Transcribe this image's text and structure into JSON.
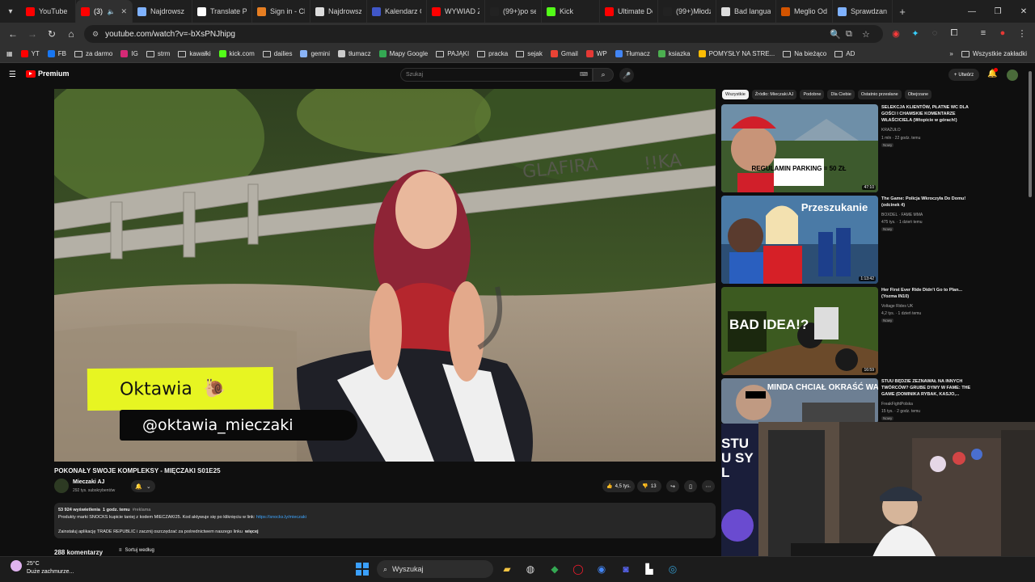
{
  "browser": {
    "tabs": [
      {
        "title": "YouTube",
        "icon": "youtube-icon",
        "color": "#ff0000"
      },
      {
        "title": "(3) I",
        "icon": "youtube-icon",
        "color": "#ff0000",
        "active": true
      },
      {
        "title": "Najdrowsz",
        "icon": "star-icon",
        "color": "#7fb2ff"
      },
      {
        "title": "Translate Pc",
        "icon": "translate-icon",
        "color": "#ffffff"
      },
      {
        "title": "Sign in - Cle",
        "icon": "clever-icon",
        "color": "#e67e22"
      },
      {
        "title": "Najdrowsz",
        "icon": "openai-icon",
        "color": "#dddddd"
      },
      {
        "title": "Kalendarz G",
        "icon": "calendar-icon",
        "color": "#4057c8"
      },
      {
        "title": "WYWIAD Z",
        "icon": "youtube-icon",
        "color": "#ff0000"
      },
      {
        "title": "(99+)po ser",
        "icon": "tiktok-icon",
        "color": "#222222"
      },
      {
        "title": "Kick",
        "icon": "kick-icon",
        "color": "#53fc18"
      },
      {
        "title": "Ultimate Do",
        "icon": "youtube-icon",
        "color": "#ff0000"
      },
      {
        "title": "(99+)Młodz",
        "icon": "tiktok-icon",
        "color": "#222222"
      },
      {
        "title": "Bad langua",
        "icon": "github-icon",
        "color": "#dddddd"
      },
      {
        "title": "Meglio Odi",
        "icon": "cookie-icon",
        "color": "#d35400"
      },
      {
        "title": "Sprawdzani",
        "icon": "star-icon",
        "color": "#7fb2ff"
      }
    ],
    "url": "youtube.com/watch?v=-bXsPNJhipg",
    "bookmarks": [
      {
        "label": "YT",
        "type": "site",
        "color": "#ff0000"
      },
      {
        "label": "FB",
        "type": "site",
        "color": "#1877f2"
      },
      {
        "label": "za darmo",
        "type": "folder"
      },
      {
        "label": "IG",
        "type": "site",
        "color": "#d62976"
      },
      {
        "label": "strm",
        "type": "folder"
      },
      {
        "label": "kawałki",
        "type": "folder"
      },
      {
        "label": "kick.com",
        "type": "site",
        "color": "#53fc18"
      },
      {
        "label": "dailies",
        "type": "folder"
      },
      {
        "label": "gemini",
        "type": "site",
        "color": "#8ab4f8"
      },
      {
        "label": "tłumacz",
        "type": "site",
        "color": "#cccccc"
      },
      {
        "label": "Mapy Google",
        "type": "site",
        "color": "#34a853"
      },
      {
        "label": "PAJĄKI",
        "type": "folder"
      },
      {
        "label": "pracka",
        "type": "folder"
      },
      {
        "label": "sejak",
        "type": "folder"
      },
      {
        "label": "Gmail",
        "type": "site",
        "color": "#ea4335"
      },
      {
        "label": "WP",
        "type": "site",
        "color": "#e53935"
      },
      {
        "label": "Tłumacz",
        "type": "site",
        "color": "#4285f4"
      },
      {
        "label": "ksiazka",
        "type": "site",
        "color": "#4caf50"
      },
      {
        "label": "POMYSŁY NA STRE...",
        "type": "site",
        "color": "#fbbc04"
      },
      {
        "label": "Na bieżąco",
        "type": "folder"
      },
      {
        "label": "AD",
        "type": "folder"
      }
    ],
    "all_bookmarks": "Wszystkie zakładki"
  },
  "youtube": {
    "logo_text": "Premium",
    "search_placeholder": "Szukaj",
    "create_label": "Utwórz",
    "video": {
      "overlay_name": "Oktawia",
      "overlay_handle": "@oktawia_mieczaki",
      "title": "POKONAŁY SWOJE KOMPLEKSY - MIĘCZAKI S01E25",
      "channel": "Mieczaki AJ",
      "subscribers": "292 tys. subskrybentów",
      "likes": "4,5 tys.",
      "dislikes": "13",
      "views": "53 924 wyświetlenia",
      "age": "1 godz. temu",
      "tag": "#reklama",
      "desc_line1": "Produkty marki SNOCKS kupicie taniej z kodem MIECZAKI25. Kod aktywuje się po kliknięciu w link:",
      "desc_link": "https://snocks.ly/mieczaki",
      "desc_line2": "Zainstaluj aplikację TRADE REPUBLIC i zacznij oszczędzać za pośrednictwem naszego linku",
      "desc_more": "więcej",
      "comments": "288 komentarzy",
      "sort_label": "Sortuj według"
    },
    "chips": [
      "Wszystkie",
      "Źródło: Mieczaki AJ",
      "Podobne",
      "Dla Ciebie",
      "Ostatnio przesłane",
      "Obejrzane"
    ],
    "recommendations": [
      {
        "title": "SELEKCJA KLIENTÓW, PŁATNE WC DLA GOŚCI I CHAMSKIE KOMENTARZE WŁAŚCICIELA (Wtopicie w górach!)",
        "channel": "KRAŻUŁO",
        "stats": "1 mln · 22 godz. temu",
        "badge": "Nowy",
        "duration": "47:10",
        "thumb_text": "REGULAMIN PARKING = 50 ZŁ"
      },
      {
        "title": "The Game: Policja Wkroczyła Do Domu! (odcinek 4)",
        "channel": "BOXDEL · FAME MMA",
        "stats": "475 tys. · 1 dzień temu",
        "badge": "Nowy",
        "duration": "1:13:42",
        "thumb_text": "Przeszukanie"
      },
      {
        "title": "Her First Ever Ride Didn't Go to Plan... (Yozma IN10)",
        "channel": "Voltage Rides UK",
        "stats": "4,2 tys. · 1 dzień temu",
        "badge": "Nowy",
        "duration": "16:59",
        "thumb_text": "BAD IDEA!?"
      },
      {
        "title": "STUU BĘDZIE ZEZNAWAŁ NA INNYCH TWÓRCÓW? GRUBE DYMY W FAME: THE GAME (DOMINIKA RYBAK, KASJO,...",
        "channel": "FreakFightPolska",
        "stats": "15 tys. · 2 godz. temu",
        "badge": "Nowy",
        "duration": "",
        "thumb_text": "MINDA CHCIAŁ OKRAŚĆ WAMPIRA?"
      }
    ],
    "partial_thumb_text": "STUU SYL"
  },
  "taskbar": {
    "temp": "25°C",
    "weather": "Duże zachmurze...",
    "search": "Wyszukaj"
  },
  "colors": {
    "background": "#0f0f0f",
    "overlay_yellow": "#e7f522",
    "link": "#3ea6ff",
    "youtube_red": "#ff0000"
  }
}
